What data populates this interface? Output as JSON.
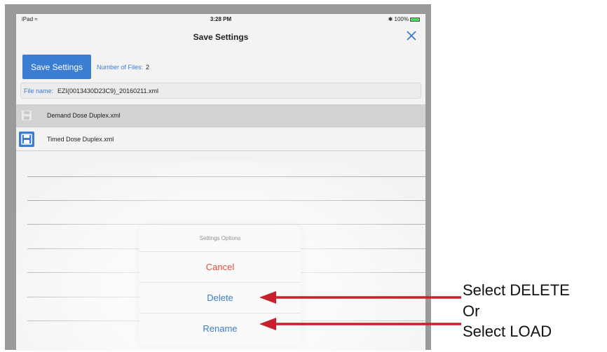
{
  "statusbar": {
    "carrier": "iPad",
    "time": "3:28 PM",
    "battery": "100%"
  },
  "navbar": {
    "title": "Save Settings"
  },
  "toolbar": {
    "save_label": "Save Settings",
    "files_label": "Number of Files:",
    "files_count": "2"
  },
  "filename": {
    "label": "File name:",
    "value": "EZI(0013430D23C9)_20160211.xml"
  },
  "files": [
    {
      "name": "Demand Dose Duplex.xml",
      "selected": true
    },
    {
      "name": "Timed Dose Duplex.xml",
      "selected": false
    }
  ],
  "sheet": {
    "title": "Settings Options",
    "cancel": "Cancel",
    "delete": "Delete",
    "rename": "Rename"
  },
  "annotations": {
    "line1": "Select DELETE",
    "line2": "Or",
    "line3": "Select LOAD"
  },
  "colors": {
    "accent": "#3b7dd0",
    "destructive": "#e74c3c",
    "arrow": "#c8202a"
  }
}
